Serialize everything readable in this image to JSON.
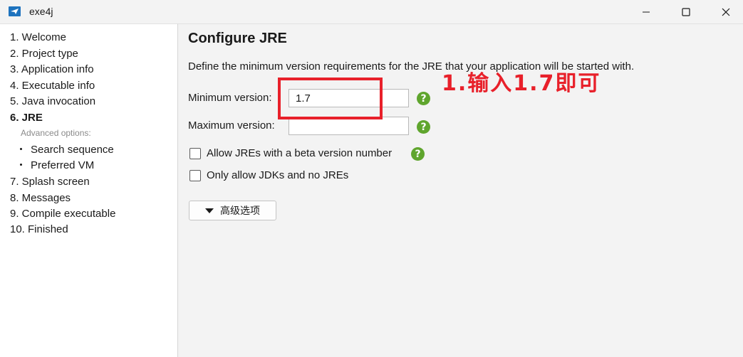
{
  "window": {
    "title": "exe4j",
    "icon": "paper-plane-icon"
  },
  "sidebar": {
    "steps": [
      {
        "label": "1. Welcome"
      },
      {
        "label": "2. Project type"
      },
      {
        "label": "3. Application info"
      },
      {
        "label": "4. Executable info"
      },
      {
        "label": "5. Java invocation"
      },
      {
        "label": "6. JRE",
        "active": true
      },
      {
        "label": "7. Splash screen"
      },
      {
        "label": "8. Messages"
      },
      {
        "label": "9. Compile executable"
      },
      {
        "label": "10. Finished"
      }
    ],
    "advanced_label": "Advanced options:",
    "sub_items": [
      {
        "label": "Search sequence"
      },
      {
        "label": "Preferred VM"
      }
    ]
  },
  "main": {
    "title": "Configure JRE",
    "description": "Define the minimum version requirements for the JRE that your application will be started with.",
    "min_version": {
      "label": "Minimum version:",
      "value": "1.7"
    },
    "max_version": {
      "label": "Maximum version:",
      "value": ""
    },
    "checkboxes": [
      {
        "label": "Allow JREs with a beta version number",
        "checked": false
      },
      {
        "label": "Only allow JDKs and no JREs",
        "checked": false
      }
    ],
    "advanced_button": "高级选项",
    "help_glyph": "?"
  },
  "annotation": {
    "text": "1.输入1.7即可",
    "color": "#e8202a"
  },
  "colors": {
    "help_green": "#5fa52d",
    "sidebar_bg": "#ffffff",
    "main_bg": "#f3f3f3"
  }
}
